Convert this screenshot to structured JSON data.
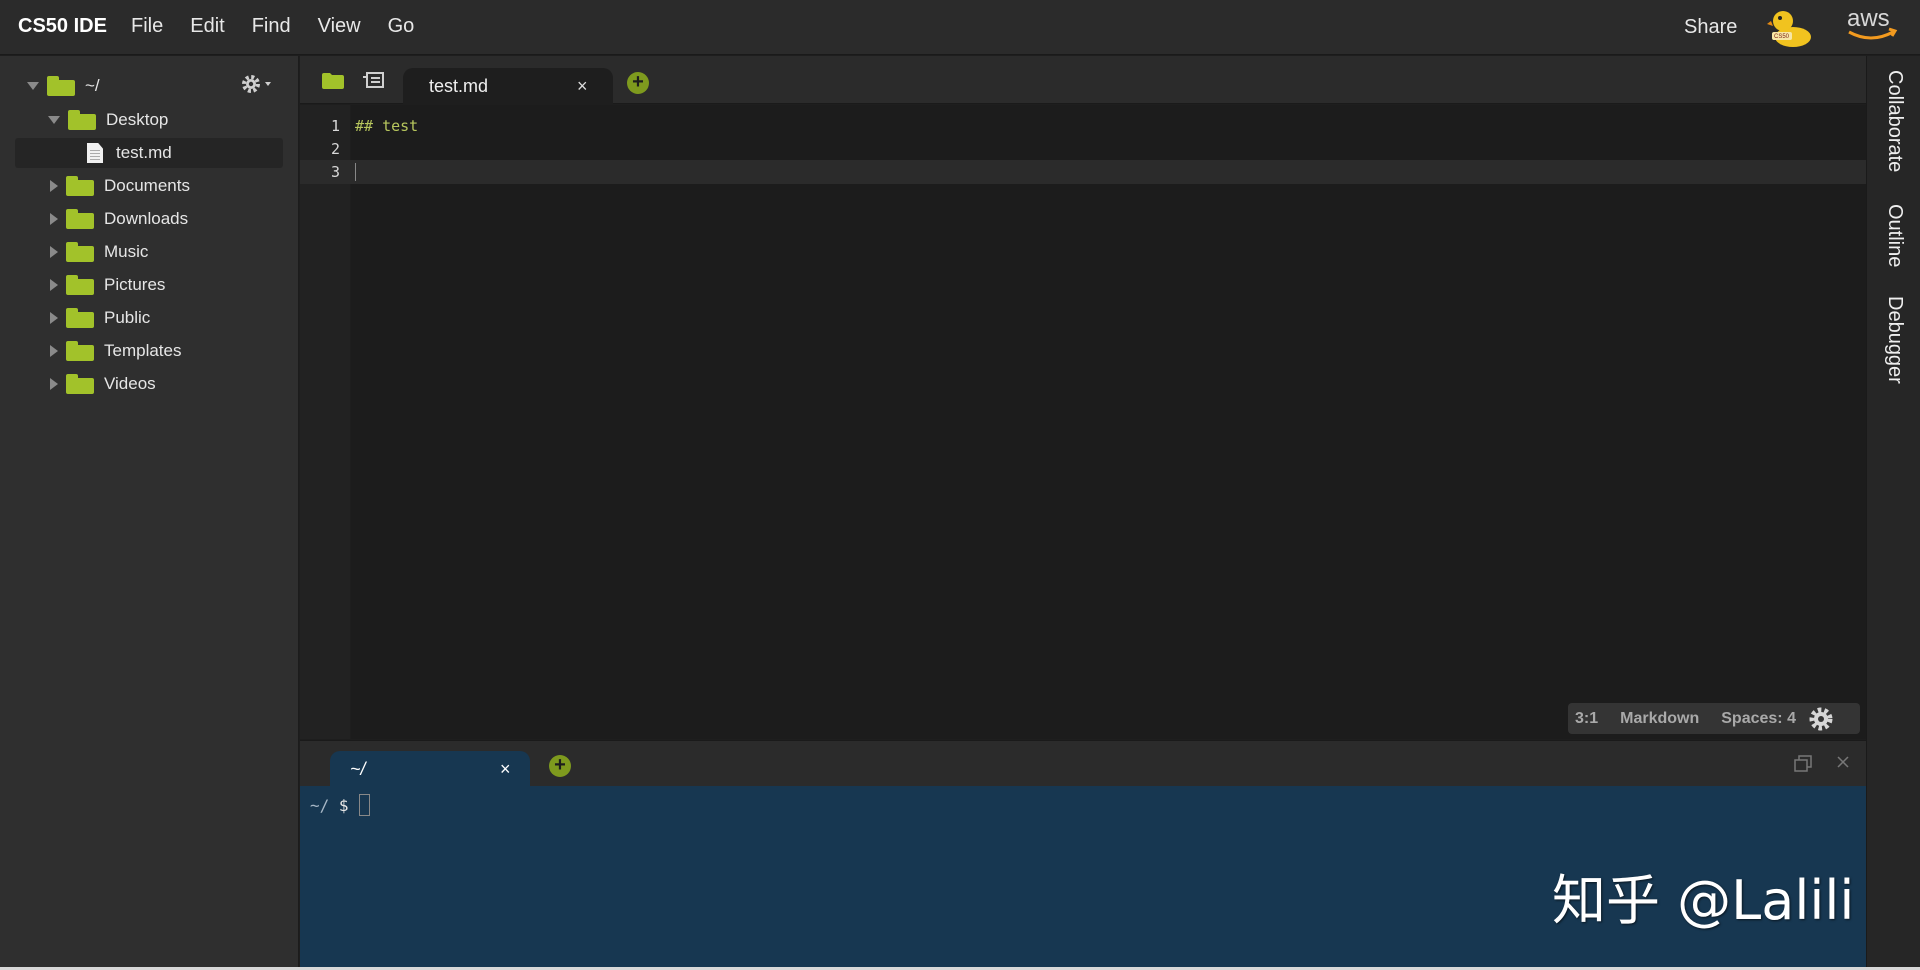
{
  "menubar": {
    "brand": "CS50 IDE",
    "menus": [
      "File",
      "Edit",
      "Find",
      "View",
      "Go"
    ],
    "share": "Share"
  },
  "sidebar": {
    "root_label": "~/",
    "items": [
      {
        "label": "Desktop",
        "type": "folder",
        "expanded": true
      },
      {
        "label": "test.md",
        "type": "file",
        "selected": true
      },
      {
        "label": "Documents",
        "type": "folder"
      },
      {
        "label": "Downloads",
        "type": "folder"
      },
      {
        "label": "Music",
        "type": "folder"
      },
      {
        "label": "Pictures",
        "type": "folder"
      },
      {
        "label": "Public",
        "type": "folder"
      },
      {
        "label": "Templates",
        "type": "folder"
      },
      {
        "label": "Videos",
        "type": "folder"
      }
    ]
  },
  "editor": {
    "tab_label": "test.md",
    "tab_close": "×",
    "new_tab": "+",
    "line_numbers": [
      "1",
      "2",
      "3"
    ],
    "lines": [
      "## test",
      "",
      ""
    ]
  },
  "status": {
    "position": "3:1",
    "language": "Markdown",
    "indent": "Spaces: 4"
  },
  "terminal": {
    "tab_label": "~/",
    "tab_close": "×",
    "new_tab": "+",
    "prompt_path": "~/",
    "prompt_symbol": "$"
  },
  "rightbar": {
    "collaborate": "Collaborate",
    "outline": "Outline",
    "debugger": "Debugger"
  },
  "watermark": "知乎 @Lalili",
  "colors": {
    "folder_green": "#a2c22a",
    "accent_green": "#7e9a1e",
    "terminal_bg": "#173751",
    "editor_bg": "#1c1c1c"
  }
}
